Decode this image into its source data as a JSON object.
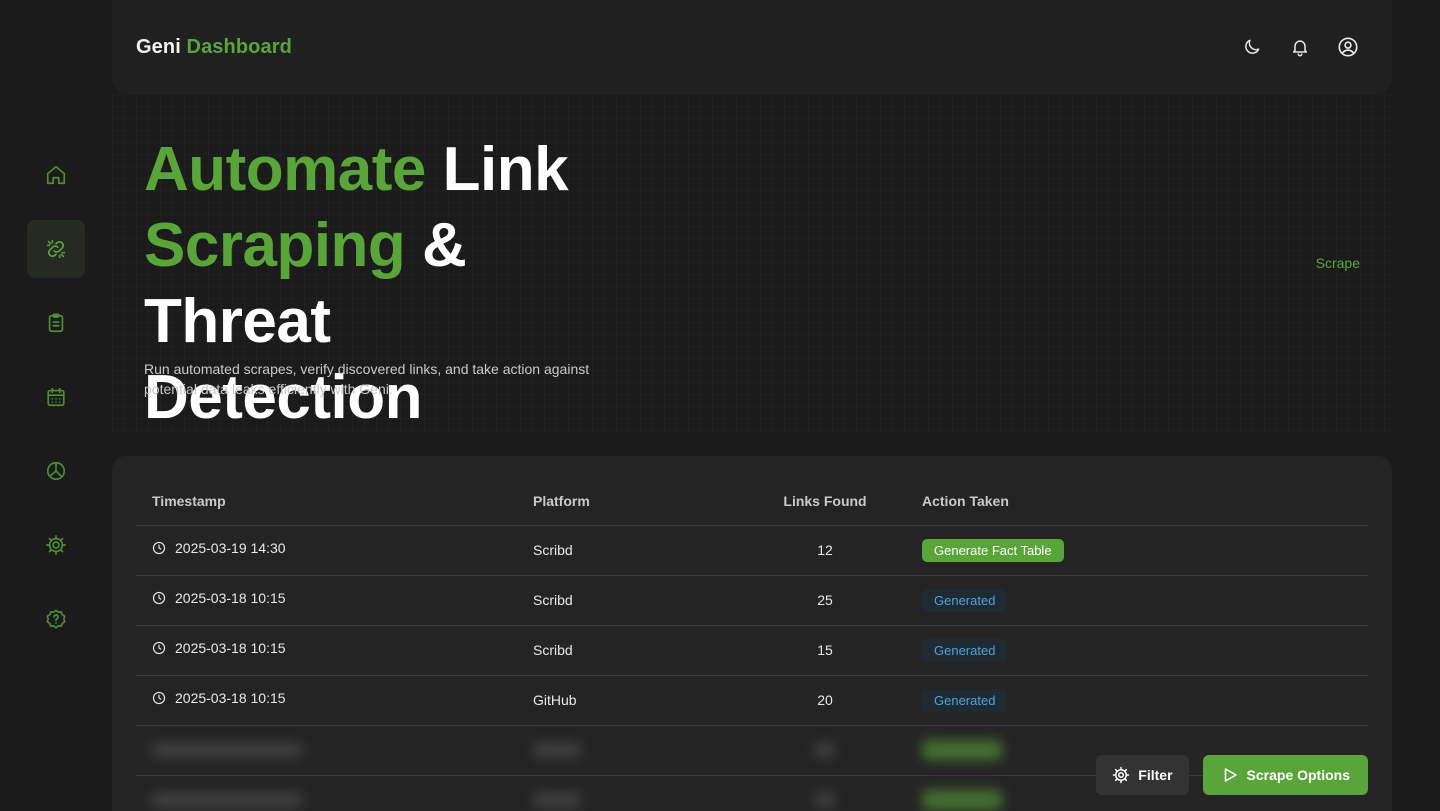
{
  "brand": {
    "name": "Geni",
    "accent": "Dashboard"
  },
  "sidebar": {
    "items": [
      {
        "icon": "home-icon",
        "active": false
      },
      {
        "icon": "link-icon",
        "active": true
      },
      {
        "icon": "clipboard-icon",
        "active": false
      },
      {
        "icon": "calendar-icon",
        "active": false
      },
      {
        "icon": "pie-chart-icon",
        "active": false
      },
      {
        "icon": "gear-icon",
        "active": false
      },
      {
        "icon": "help-icon",
        "active": false
      }
    ]
  },
  "header": {
    "icons": [
      "moon-icon",
      "bell-icon",
      "user-icon"
    ]
  },
  "hero": {
    "title_1": "Automate",
    "title_2": " Link",
    "title_3": "Scraping",
    "title_4": " & Threat",
    "title_5": "Detection",
    "subtitle": "Run automated scrapes, verify discovered links, and take action against potential data leaks efficiently with Geni.",
    "scrape_link": "Scrape"
  },
  "table": {
    "headers": [
      "Timestamp",
      "Platform",
      "Links Found",
      "Action Taken"
    ],
    "rows": [
      {
        "timestamp": "2025-03-19 14:30",
        "platform": "Scribd",
        "links": "12",
        "action": "Generate Fact Table",
        "action_type": "button"
      },
      {
        "timestamp": "2025-03-18 10:15",
        "platform": "Scribd",
        "links": "25",
        "action": "Generated",
        "action_type": "badge"
      },
      {
        "timestamp": "2025-03-18 10:15",
        "platform": "Scribd",
        "links": "15",
        "action": "Generated",
        "action_type": "badge"
      },
      {
        "timestamp": "2025-03-18 10:15",
        "platform": "GitHub",
        "links": "20",
        "action": "Generated",
        "action_type": "badge"
      }
    ]
  },
  "actions": {
    "filter_label": "Filter",
    "scrape_options_label": "Scrape Options"
  },
  "colors": {
    "accent": "#5aa53a",
    "badge_text": "#4fa3d6",
    "background": "#1b1b1b",
    "card": "#242424"
  }
}
